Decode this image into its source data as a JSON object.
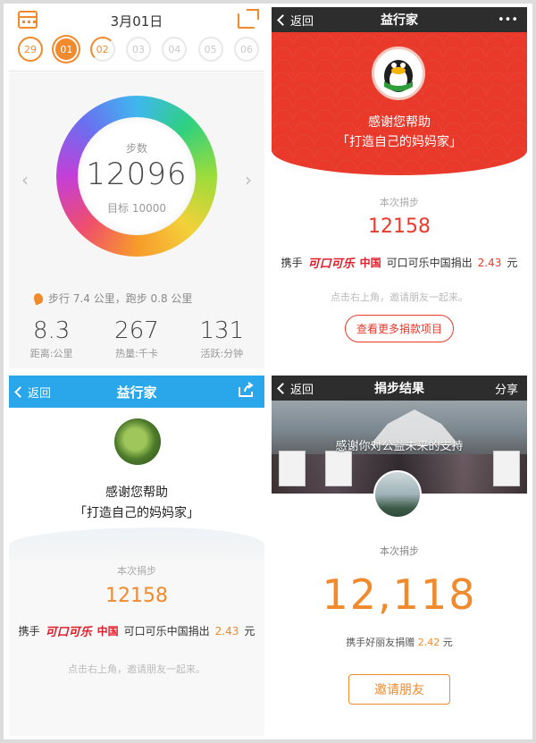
{
  "panel_steps": {
    "date": "3月01日",
    "days": [
      "29",
      "01",
      "02",
      "03",
      "04",
      "05",
      "06"
    ],
    "ring_label": "步数",
    "steps": "12096",
    "goal": "目标 10000",
    "walk_summary": "步行 7.4 公里，跑步 0.8 公里",
    "stats": [
      {
        "value": "8.3",
        "label": "距离:公里"
      },
      {
        "value": "267",
        "label": "热量:千卡"
      },
      {
        "value": "131",
        "label": "活跃:分钟"
      }
    ]
  },
  "panel_red": {
    "back": "返回",
    "title": "益行家",
    "more": "•••",
    "thanks_line1": "感谢您帮助",
    "thanks_line2": "「打造自己的妈妈家」",
    "label": "本次捐步",
    "steps": "12158",
    "donor_prefix": "携手",
    "sponsor_logo": "可口可乐",
    "sponsor_region": "中国",
    "donor_text": "可口可乐中国捐出",
    "amount": "2.43",
    "unit": "元",
    "hint": "点击右上角，邀请朋友一起来。",
    "button": "查看更多捐款项目"
  },
  "panel_blue": {
    "back": "返回",
    "title": "益行家",
    "thanks_line1": "感谢您帮助",
    "thanks_line2": "「打造自己的妈妈家」",
    "label": "本次捐步",
    "steps": "12158",
    "donor_prefix": "携手",
    "sponsor_logo": "可口可乐",
    "sponsor_region": "中国",
    "donor_text": "可口可乐中国捐出",
    "amount": "2.43",
    "unit": "元",
    "hint": "点击右上角，邀请朋友一起来。"
  },
  "panel_result": {
    "back": "返回",
    "title": "捐步结果",
    "share": "分享",
    "photo_text": "感谢你对公益未来的支持",
    "label": "本次捐步",
    "steps": "12,118",
    "sub_prefix": "携手好丽友捐赠",
    "amount": "2.42",
    "unit": "元",
    "button": "邀请朋友"
  }
}
